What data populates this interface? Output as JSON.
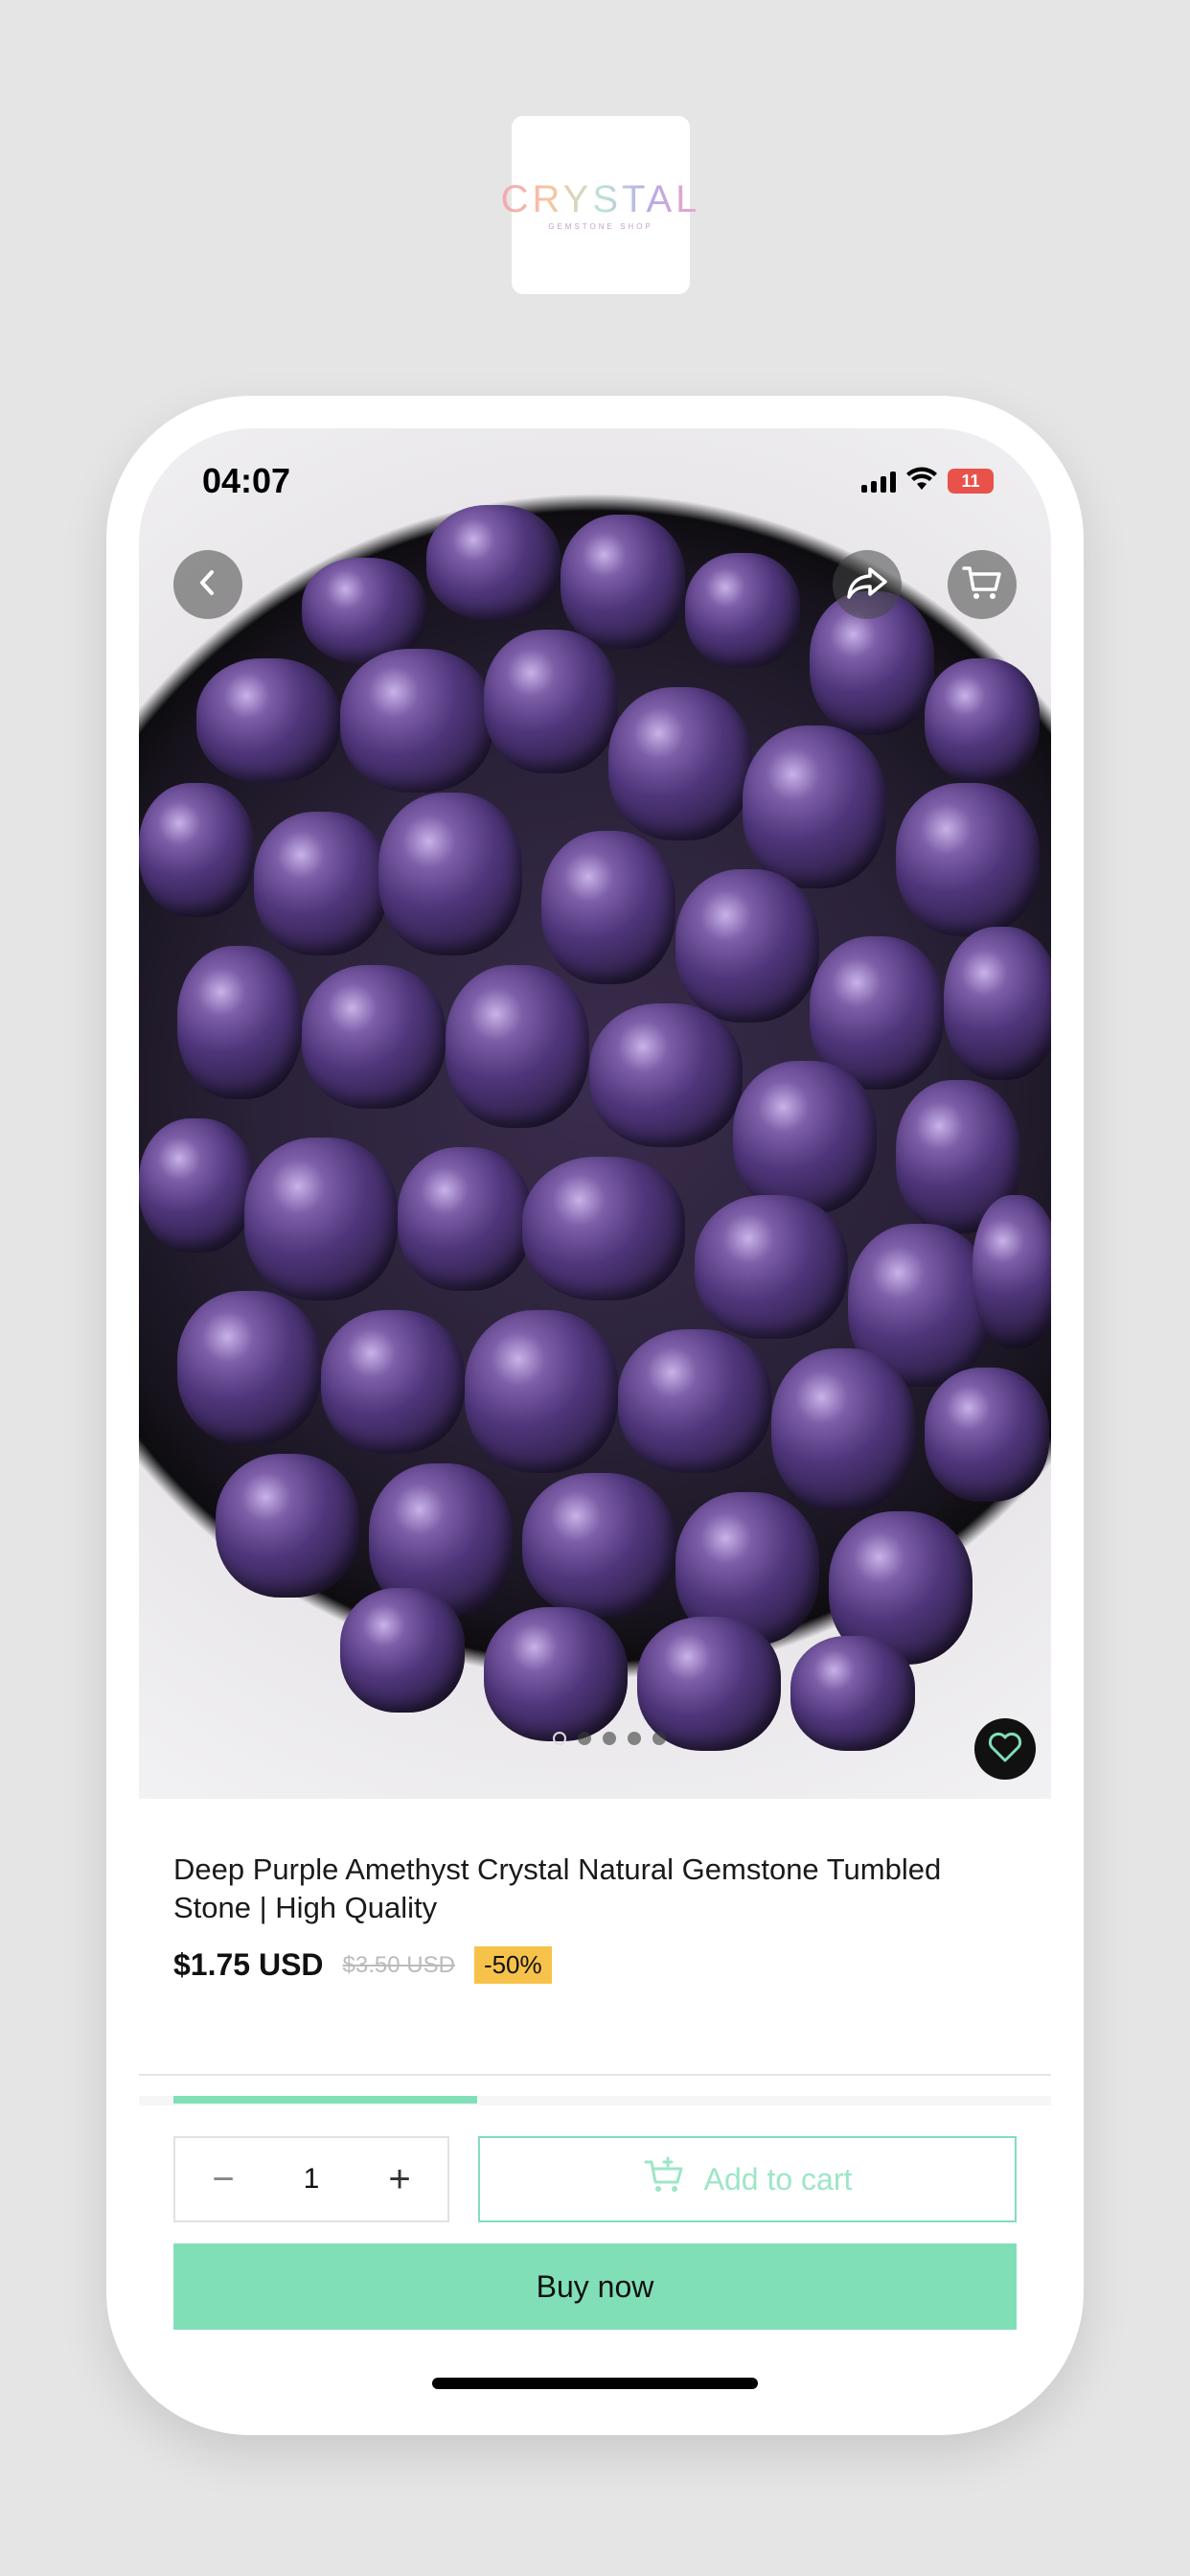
{
  "brand": {
    "logo_text": "CRYSTAL",
    "logo_subtext": "GEMSTONE SHOP"
  },
  "statusbar": {
    "time": "04:07",
    "battery": "11"
  },
  "hero": {
    "image_alt": "Bowl of tumbled purple amethyst stones",
    "carousel": {
      "count": 5,
      "active": 1
    }
  },
  "product": {
    "title": "Deep Purple Amethyst Crystal Natural Gemstone Tumbled Stone | High Quality",
    "price": "$1.75 USD",
    "compare_price": "$3.50 USD",
    "discount": "-50%"
  },
  "progress": 0.36,
  "purchase": {
    "quantity": "1",
    "minus": "−",
    "plus": "+",
    "add_to_cart": "Add to cart",
    "buy_now": "Buy now"
  },
  "colors": {
    "accent": "#81dfb8",
    "discount_badge": "#f7c24a",
    "battery": "#e8524a"
  },
  "icons": [
    "chevron-left-icon",
    "share-icon",
    "cart-icon",
    "heart-icon",
    "cart-plus-icon",
    "signal-icon",
    "wifi-icon",
    "battery-icon"
  ]
}
